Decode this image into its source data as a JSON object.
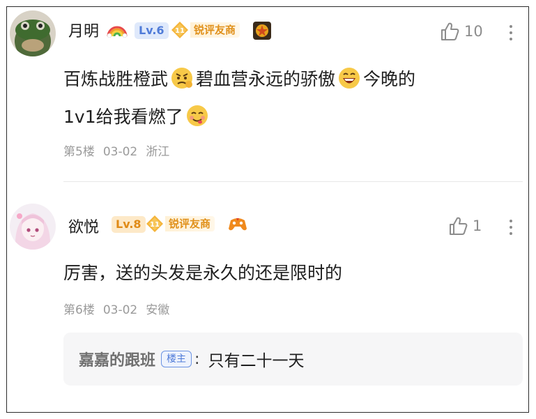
{
  "comments": [
    {
      "username": "月明",
      "level": "Lv.6",
      "merchant_level": "11",
      "merchant_label": "锐评友商",
      "likes": "10",
      "content_parts": [
        "百炼战胜橙武",
        "碧血营永远的骄傲",
        "今晚的",
        "1v1给我看燃了"
      ],
      "floor": "第5楼",
      "date": "03-02",
      "location": "浙江"
    },
    {
      "username": "欲悦",
      "level": "Lv.8",
      "merchant_level": "11",
      "merchant_label": "锐评友商",
      "likes": "1",
      "content": "厉害，送的头发是永久的还是限时的",
      "floor": "第6楼",
      "date": "03-02",
      "location": "安徽",
      "reply": {
        "user": "嘉嘉的跟班",
        "tag": "楼主",
        "colon": ":",
        "text": "只有二十一天"
      }
    }
  ],
  "colors": {
    "level6_bg": "#dfe9fb",
    "level6_text": "#4f7bd8",
    "level8_bg": "#fde9c8",
    "level8_text": "#e08a16",
    "merchant_text": "#e0901a",
    "meta_text": "#9a9a9a",
    "reply_bg": "#f6f6f7"
  },
  "icons": [
    "avatar-frog",
    "rainbow-emoji",
    "merchant-gem-icon",
    "medal-icon",
    "thumbs-up-icon",
    "more-vertical-icon",
    "angry-face-emoji",
    "grinning-face-emoji",
    "yum-face-emoji",
    "avatar-anime-girl",
    "game-controller-icon"
  ]
}
